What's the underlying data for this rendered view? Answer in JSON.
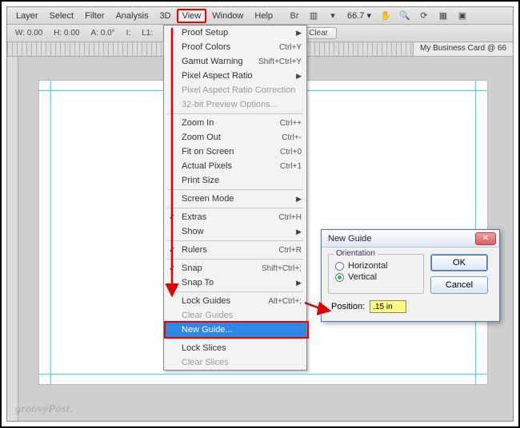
{
  "menubar": {
    "items": [
      "Layer",
      "Select",
      "Filter",
      "Analysis",
      "3D",
      "View",
      "Window",
      "Help"
    ],
    "active_index": 5,
    "zoom_pct": "66.7"
  },
  "optionsbar": {
    "w": "W: 0.00",
    "h": "H: 0.00",
    "a": "A: 0.0°",
    "i": "I:",
    "l1": "L1:",
    "clear": "Clear"
  },
  "document_tab": "My Business Card @ 66",
  "dropdown": {
    "groups": [
      [
        {
          "label": "Proof Setup",
          "submenu": true
        },
        {
          "label": "Proof Colors",
          "shortcut": "Ctrl+Y"
        },
        {
          "label": "Gamut Warning",
          "shortcut": "Shift+Ctrl+Y"
        },
        {
          "label": "Pixel Aspect Ratio",
          "submenu": true
        },
        {
          "label": "Pixel Aspect Ratio Correction",
          "disabled": true
        },
        {
          "label": "32-bit Preview Options...",
          "disabled": true
        }
      ],
      [
        {
          "label": "Zoom In",
          "shortcut": "Ctrl++"
        },
        {
          "label": "Zoom Out",
          "shortcut": "Ctrl+-"
        },
        {
          "label": "Fit on Screen",
          "shortcut": "Ctrl+0"
        },
        {
          "label": "Actual Pixels",
          "shortcut": "Ctrl+1"
        },
        {
          "label": "Print Size"
        }
      ],
      [
        {
          "label": "Screen Mode",
          "submenu": true
        }
      ],
      [
        {
          "label": "Extras",
          "shortcut": "Ctrl+H",
          "checked": true
        },
        {
          "label": "Show",
          "submenu": true
        }
      ],
      [
        {
          "label": "Rulers",
          "shortcut": "Ctrl+R",
          "checked": true
        }
      ],
      [
        {
          "label": "Snap",
          "shortcut": "Shift+Ctrl+;",
          "checked": true
        },
        {
          "label": "Snap To",
          "submenu": true
        }
      ],
      [
        {
          "label": "Lock Guides",
          "shortcut": "Alt+Ctrl+;"
        },
        {
          "label": "Clear Guides",
          "disabled": true
        },
        {
          "label": "New Guide...",
          "highlight": true
        }
      ],
      [
        {
          "label": "Lock Slices"
        },
        {
          "label": "Clear Slices",
          "disabled": true
        }
      ]
    ]
  },
  "dialog": {
    "title": "New Guide",
    "group_legend": "Orientation",
    "radio_h": "Horizontal",
    "radio_v": "Vertical",
    "selected": "v",
    "ok": "OK",
    "cancel": "Cancel",
    "position_label": "Position:",
    "position_value": ".15 in"
  },
  "watermark": "groovyPost."
}
